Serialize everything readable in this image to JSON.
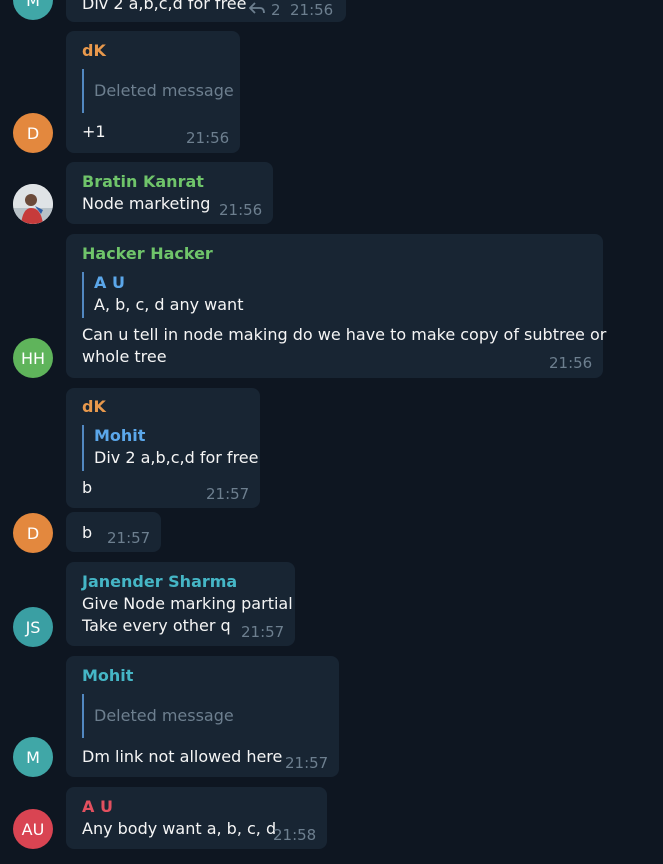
{
  "colors": {
    "background": "#0e1621",
    "bubble": "#182533",
    "quote_bar": "#5288c1",
    "time": "#6d7f8f",
    "deleted_text": "#6d7f8f"
  },
  "messages": [
    {
      "avatar": {
        "initials": "M",
        "color": "#40a7a7"
      },
      "quote_text": "Div 2 a,b,c,d for free",
      "reply_count": "2",
      "time": "21:56"
    },
    {
      "sender": "dK",
      "sender_color": "#e9994c",
      "avatar": {
        "initials": "D",
        "color": "#e3883e"
      },
      "quote": {
        "deleted": "Deleted message"
      },
      "text": "+1",
      "time": "21:56"
    },
    {
      "sender": "Bratin Kanrat",
      "sender_color": "#6fc46a",
      "avatar": {
        "type": "photo"
      },
      "text": "Node marketing",
      "time": "21:56"
    },
    {
      "sender": "Hacker Hacker",
      "sender_color": "#6fc46a",
      "avatar": {
        "initials": "HH",
        "color": "#5fb45b"
      },
      "quote": {
        "name": "A U",
        "text": "A, b, c, d any want"
      },
      "text_lines": [
        "Can u tell in node making do we have to make copy of subtree or",
        "whole tree"
      ],
      "time": "21:56"
    },
    {
      "sender": "dK",
      "sender_color": "#e9994c",
      "quote": {
        "name": "Mohit",
        "text": "Div 2 a,b,c,d for free"
      },
      "text": "b",
      "time": "21:57"
    },
    {
      "avatar": {
        "initials": "D",
        "color": "#e3883e"
      },
      "text": "b",
      "time": "21:57"
    },
    {
      "sender": "Janender Sharma",
      "sender_color": "#45b6c6",
      "avatar": {
        "initials": "JS",
        "color": "#3a9fa3"
      },
      "text_lines": [
        "Give Node marking partial",
        "Take every other q"
      ],
      "time": "21:57"
    },
    {
      "sender": "Mohit",
      "sender_color": "#45b6c6",
      "avatar": {
        "initials": "M",
        "color": "#40a7a7"
      },
      "quote": {
        "deleted": "Deleted message"
      },
      "text": "Dm link not allowed here",
      "time": "21:57"
    },
    {
      "sender": "A U",
      "sender_color": "#e3505f",
      "avatar": {
        "initials": "AU",
        "color": "#d94452"
      },
      "text": "Any body want a, b, c, d",
      "time": "21:58"
    }
  ]
}
